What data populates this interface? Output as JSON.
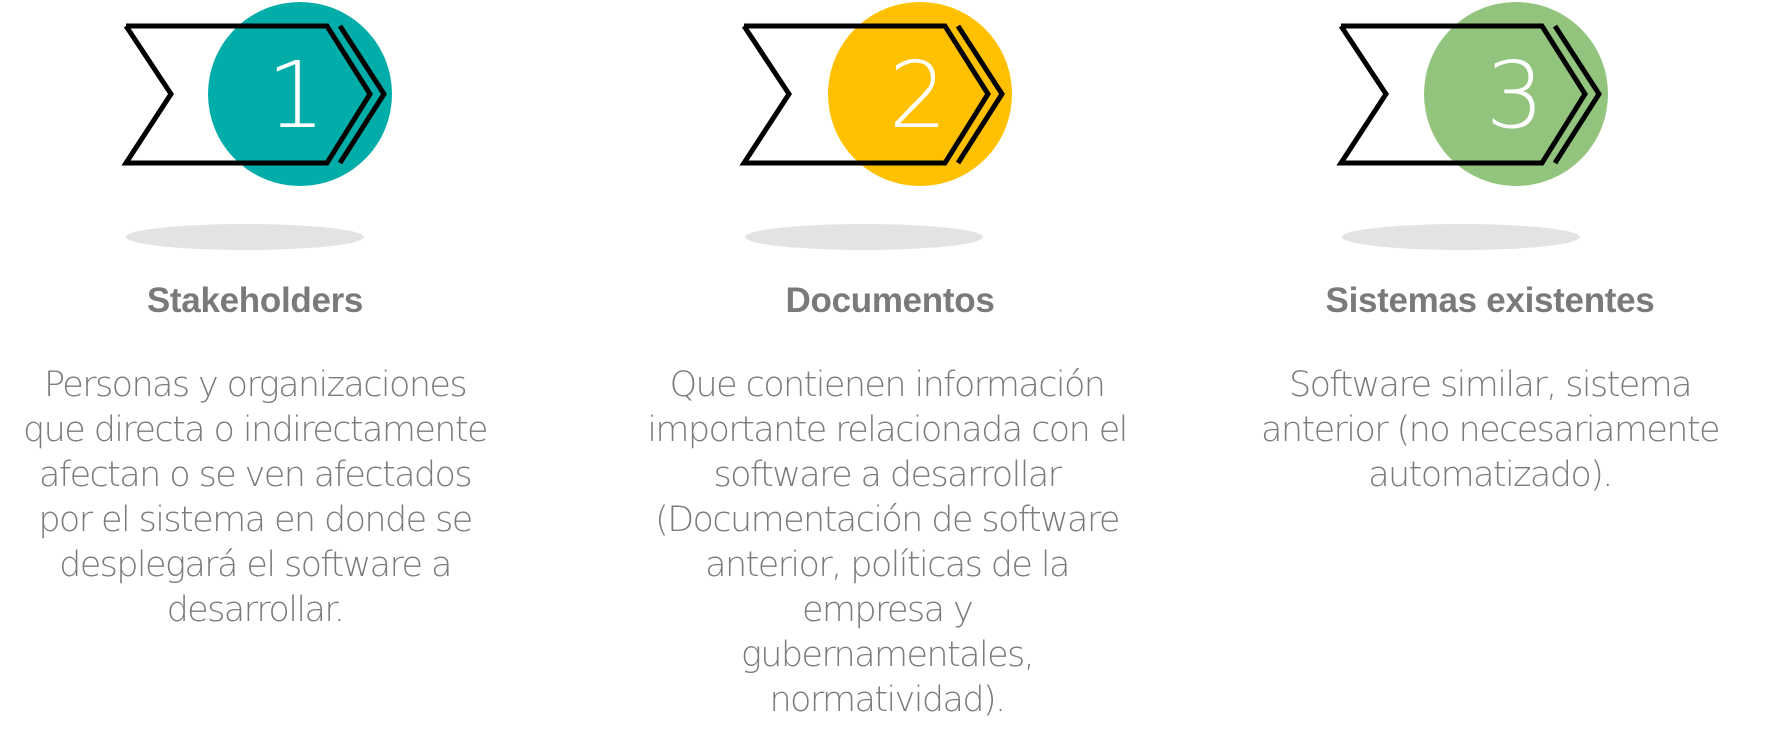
{
  "steps": [
    {
      "number": "1",
      "title": "Stakeholders",
      "description": "Personas y organizaciones\nque directa o indirectamente\nafectan o se ven afectados\npor el sistema en donde se\ndesplegará el software a\ndesarrollar.",
      "color": "#00ADA9",
      "icon": "chevron-arrow-icon"
    },
    {
      "number": "2",
      "title": "Documentos",
      "description": "Que contienen información\nimportante relacionada con el\nsoftware a desarrollar\n(Documentación de software\nanterior, políticas de la empresa y\ngubernamentales, normatividad).",
      "color": "#FFC000",
      "icon": "chevron-arrow-icon"
    },
    {
      "number": "3",
      "title": "Sistemas existentes",
      "description": "Software similar, sistema\nanterior (no necesariamente\nautomatizado).",
      "color": "#92C47D",
      "icon": "chevron-arrow-icon"
    }
  ]
}
